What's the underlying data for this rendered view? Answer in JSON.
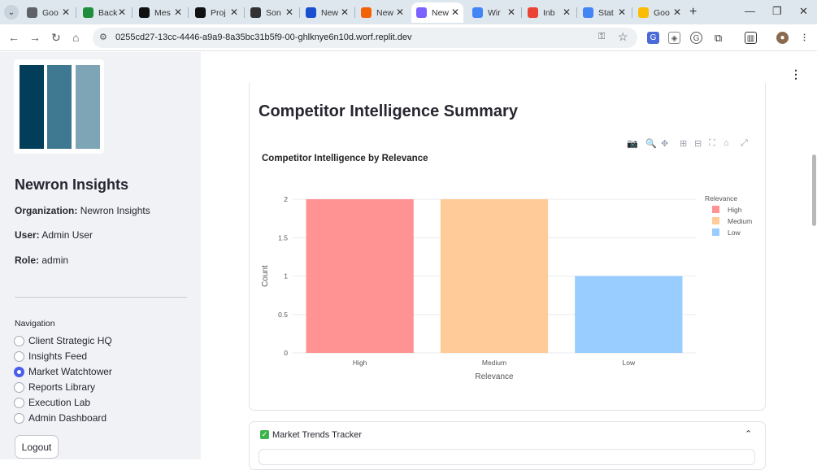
{
  "browser": {
    "tabs": [
      {
        "label": "Goo",
        "icon": "globe-icon",
        "color": "#5f6368"
      },
      {
        "label": "Back",
        "icon": "sheets-icon",
        "color": "#1e8e3e"
      },
      {
        "label": "Mes",
        "icon": "vp-icon",
        "color": "#111111"
      },
      {
        "label": "Proj",
        "icon": "vp-icon",
        "color": "#111111"
      },
      {
        "label": "Son",
        "icon": "chatgpt-icon",
        "color": "#333333"
      },
      {
        "label": "New",
        "icon": "b-icon",
        "color": "#1a4fd0"
      },
      {
        "label": "New",
        "icon": "replit-icon",
        "color": "#f26207"
      },
      {
        "label": "New",
        "icon": "chart-icon",
        "color": "#7b61ff",
        "active": true
      },
      {
        "label": "Wir",
        "icon": "docs-icon",
        "color": "#4285f4"
      },
      {
        "label": "Inb",
        "icon": "gmail-icon",
        "color": "#ea4335"
      },
      {
        "label": "Stat",
        "icon": "status-icon",
        "color": "#4285f4"
      },
      {
        "label": "Goo",
        "icon": "keep-icon",
        "color": "#fbbc04"
      }
    ],
    "url": "0255cd27-13cc-4446-a9a9-8a35bc31b5f9-00-ghlknye6n10d.worf.replit.dev"
  },
  "sidebar": {
    "brand": "Newron Insights",
    "organization_label": "Organization:",
    "organization_value": "Newron Insights",
    "user_label": "User:",
    "user_value": "Admin User",
    "role_label": "Role:",
    "role_value": "admin",
    "nav_title": "Navigation",
    "nav_items": [
      {
        "label": "Client Strategic HQ",
        "selected": false
      },
      {
        "label": "Insights Feed",
        "selected": false
      },
      {
        "label": "Market Watchtower",
        "selected": true
      },
      {
        "label": "Reports Library",
        "selected": false
      },
      {
        "label": "Execution Lab",
        "selected": false
      },
      {
        "label": "Admin Dashboard",
        "selected": false
      }
    ],
    "logout_label": "Logout",
    "logo_colors": [
      "#023d5a",
      "#3f7891",
      "#7ea5b6"
    ]
  },
  "main": {
    "section_title": "Competitor Intelligence Summary",
    "expander_label": "Market Trends Tracker",
    "expander_checked": true
  },
  "chart_data": {
    "type": "bar",
    "title": "Competitor Intelligence by Relevance",
    "xlabel": "Relevance",
    "ylabel": "Count",
    "categories": [
      "High",
      "Medium",
      "Low"
    ],
    "values": [
      2,
      2,
      1
    ],
    "colors": [
      "#ff9393",
      "#ffcc99",
      "#99ccff"
    ],
    "ylim": [
      0,
      2
    ],
    "yticks": [
      "0",
      "0.5",
      "1",
      "1.5",
      "2"
    ],
    "grid": true,
    "legend": {
      "title": "Relevance",
      "placement": "top-right",
      "entries": [
        "High",
        "Medium",
        "Low"
      ]
    }
  }
}
